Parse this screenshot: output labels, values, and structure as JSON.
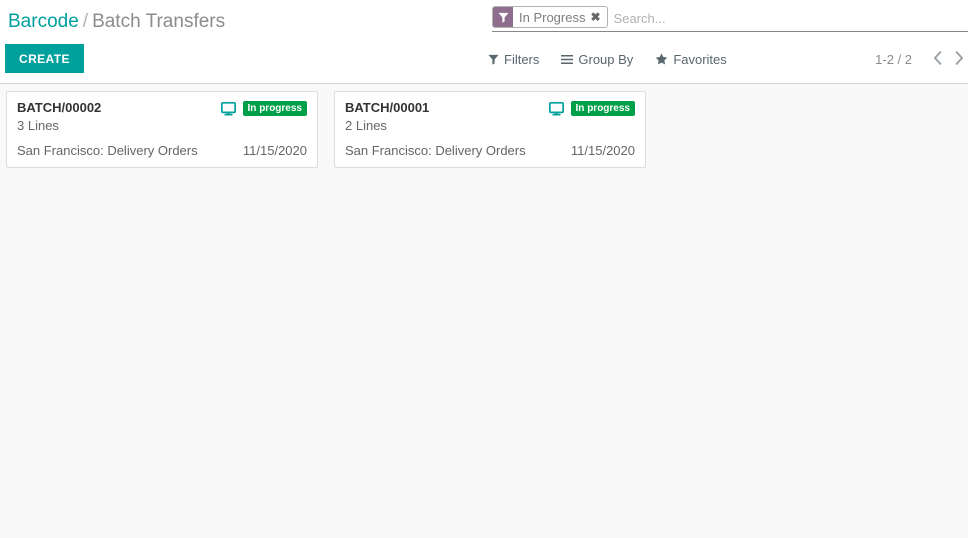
{
  "breadcrumb": {
    "root": "Barcode",
    "separator": "/",
    "current": "Batch Transfers"
  },
  "toolbar": {
    "create_label": "CREATE"
  },
  "search": {
    "placeholder": "Search...",
    "value": "",
    "facet": {
      "icon": "filter-funnel-icon",
      "label": "In Progress",
      "remove_label": "✖"
    }
  },
  "menus": [
    {
      "label": "Filters",
      "icon": "filter-funnel-icon",
      "name": "filters-menu"
    },
    {
      "label": "Group By",
      "icon": "hamburger-bars-icon",
      "name": "group-by-menu"
    },
    {
      "label": "Favorites",
      "icon": "star-icon",
      "name": "favorites-menu"
    }
  ],
  "pager": {
    "value": "1-2 / 2",
    "previous_icon": "chevron-left-icon",
    "next_icon": "chevron-right-icon"
  },
  "colors": {
    "accent_teal": "#00a09d",
    "badge_green": "#00a04a",
    "facet_purple": "#8f6d8f",
    "content_bg": "#f9f9f9"
  },
  "kanban": {
    "cards": [
      {
        "name": "BATCH/00002",
        "lines": "3 Lines",
        "device_icon": "monitor-icon",
        "status": "In progress",
        "location": "San Francisco: Delivery Orders",
        "date": "11/15/2020"
      },
      {
        "name": "BATCH/00001",
        "lines": "2 Lines",
        "device_icon": "monitor-icon",
        "status": "In progress",
        "location": "San Francisco: Delivery Orders",
        "date": "11/15/2020"
      }
    ]
  }
}
